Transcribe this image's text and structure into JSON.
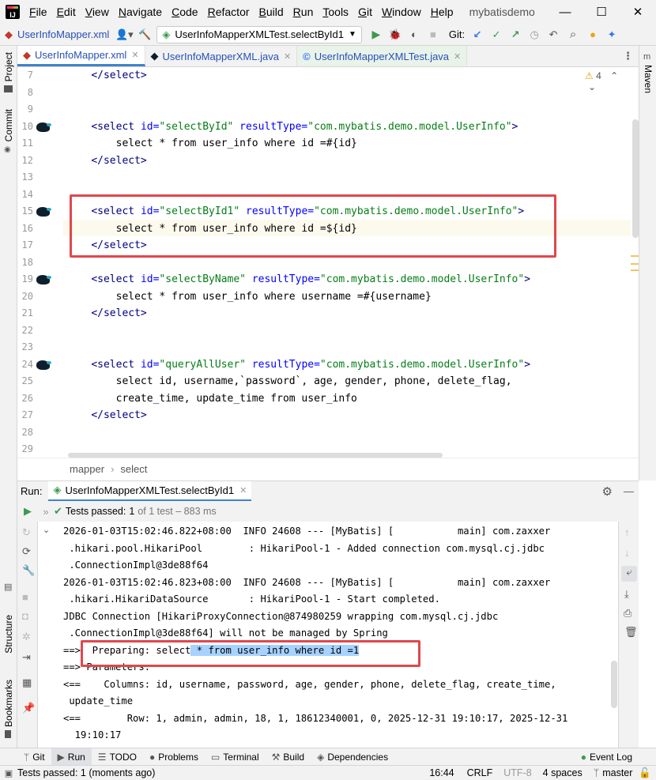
{
  "menu": {
    "items": [
      "File",
      "Edit",
      "View",
      "Navigate",
      "Code",
      "Refactor",
      "Build",
      "Run",
      "Tools",
      "Git",
      "Window",
      "Help"
    ],
    "project_title": "mybatisdemo"
  },
  "window_controls": {
    "minimize": "—",
    "maximize": "☐",
    "close": "✕"
  },
  "toolbar": {
    "nav_file": "UserInfoMapper.xml",
    "run_config": "UserInfoMapperXMLTest.selectById1",
    "git_label": "Git:"
  },
  "tabs": [
    {
      "label": "UserInfoMapper.xml",
      "active": true
    },
    {
      "label": "UserInfoMapperXML.java",
      "active": false
    },
    {
      "label": "UserInfoMapperXMLTest.java",
      "active": false
    }
  ],
  "side_tools": {
    "left": [
      "Project",
      "Commit",
      "Structure",
      "Bookmarks"
    ],
    "right": [
      "Maven"
    ]
  },
  "editor": {
    "warnings": "4",
    "line_numbers": [
      "7",
      "8",
      "9",
      "10",
      "11",
      "12",
      "13",
      "14",
      "15",
      "16",
      "17",
      "18",
      "19",
      "20",
      "21",
      "22",
      "23",
      "24",
      "25",
      "26",
      "27",
      "28",
      "29"
    ],
    "mapper_icon_lines": [
      "10",
      "15",
      "19",
      "24"
    ],
    "lines": [
      {
        "indent": "    ",
        "parts": [
          [
            "tag",
            "</select>"
          ]
        ]
      },
      {
        "indent": "",
        "parts": []
      },
      {
        "indent": "",
        "parts": []
      },
      {
        "indent": "    ",
        "parts": [
          [
            "tag",
            "<select "
          ],
          [
            "attr",
            "id="
          ],
          [
            "val",
            "\"selectById\""
          ],
          [
            "attr",
            " resultType="
          ],
          [
            "val",
            "\"com.mybatis.demo.model.UserInfo\""
          ],
          [
            "tag",
            ">"
          ]
        ]
      },
      {
        "indent": "        ",
        "parts": [
          [
            "text",
            "select * from user_info where id =#{id}"
          ]
        ]
      },
      {
        "indent": "    ",
        "parts": [
          [
            "tag",
            "</select>"
          ]
        ]
      },
      {
        "indent": "",
        "parts": []
      },
      {
        "indent": "",
        "parts": []
      },
      {
        "indent": "    ",
        "parts": [
          [
            "tag",
            "<select "
          ],
          [
            "attr",
            "id="
          ],
          [
            "val",
            "\"selectById1\""
          ],
          [
            "attr",
            " resultType="
          ],
          [
            "val",
            "\"com.mybatis.demo.model.UserInfo\""
          ],
          [
            "tag",
            ">"
          ]
        ]
      },
      {
        "indent": "        ",
        "parts": [
          [
            "text",
            "select * from user_info where id =${id}"
          ]
        ]
      },
      {
        "indent": "    ",
        "parts": [
          [
            "tag",
            "</select>"
          ]
        ]
      },
      {
        "indent": "",
        "parts": []
      },
      {
        "indent": "    ",
        "parts": [
          [
            "tag",
            "<select "
          ],
          [
            "attr",
            "id="
          ],
          [
            "val",
            "\"selectByName\""
          ],
          [
            "attr",
            " resultType="
          ],
          [
            "val",
            "\"com.mybatis.demo.model.UserInfo\""
          ],
          [
            "tag",
            ">"
          ]
        ]
      },
      {
        "indent": "        ",
        "parts": [
          [
            "text",
            "select * from user_info where username =#{username}"
          ]
        ]
      },
      {
        "indent": "    ",
        "parts": [
          [
            "tag",
            "</select>"
          ]
        ]
      },
      {
        "indent": "",
        "parts": []
      },
      {
        "indent": "",
        "parts": []
      },
      {
        "indent": "    ",
        "parts": [
          [
            "tag",
            "<select "
          ],
          [
            "attr",
            "id="
          ],
          [
            "val",
            "\"queryAllUser\""
          ],
          [
            "attr",
            " resultType="
          ],
          [
            "val",
            "\"com.mybatis.demo.model.UserInfo\""
          ],
          [
            "tag",
            ">"
          ]
        ]
      },
      {
        "indent": "        ",
        "parts": [
          [
            "text",
            "select id, username,`password`, age, gender, phone, delete_flag,"
          ]
        ]
      },
      {
        "indent": "        ",
        "parts": [
          [
            "text",
            "create_time, update_time from user_info"
          ]
        ]
      },
      {
        "indent": "    ",
        "parts": [
          [
            "tag",
            "</select>"
          ]
        ]
      },
      {
        "indent": "",
        "parts": []
      },
      {
        "indent": "",
        "parts": []
      }
    ]
  },
  "breadcrumb": [
    "mapper",
    "select"
  ],
  "run_panel": {
    "label": "Run:",
    "tab": "UserInfoMapperXMLTest.selectById1",
    "status_passed": "Tests passed:",
    "status_count": "1",
    "status_rest": "of 1 test – 883 ms"
  },
  "console": [
    "2026-01-03T15:02:46.822+08:00  INFO 24608 --- [MyBatis] [           main] com.zaxxer",
    " .hikari.pool.HikariPool        : HikariPool-1 - Added connection com.mysql.cj.jdbc",
    " .ConnectionImpl@3de88f64",
    "2026-01-03T15:02:46.823+08:00  INFO 24608 --- [MyBatis] [           main] com.zaxxer",
    " .hikari.HikariDataSource       : HikariPool-1 - Start completed.",
    "JDBC Connection [HikariProxyConnection@874980259 wrapping com.mysql.cj.jdbc",
    " .ConnectionImpl@3de88f64] will not be managed by Spring",
    "==>  Preparing: select * from user_info where id =1",
    "==> Parameters: ",
    "<==    Columns: id, username, password, age, gender, phone, delete_flag, create_time,",
    " update_time",
    "<==        Row: 1, admin, admin, 18, 1, 18612340001, 0, 2025-12-31 19:10:17, 2025-12-31",
    "  19:10:17"
  ],
  "console_highlight": {
    "prefix": "==>  Preparing: select",
    "selected": " * from user_info where id =1"
  },
  "bottom_tools": [
    "Git",
    "Run",
    "TODO",
    "Problems",
    "Terminal",
    "Build",
    "Dependencies"
  ],
  "event_log": "Event Log",
  "status": {
    "message": "Tests passed: 1 (moments ago)",
    "position": "16:44",
    "line_sep": "CRLF",
    "encoding": "UTF-8",
    "indent": "4 spaces",
    "branch": "master"
  },
  "colors": {
    "tag": "#000080",
    "attr": "#0000ff",
    "value": "#067d17",
    "highlight": "#e0474c",
    "selection": "#a6d2ff",
    "passed": "#3c9a4c"
  }
}
